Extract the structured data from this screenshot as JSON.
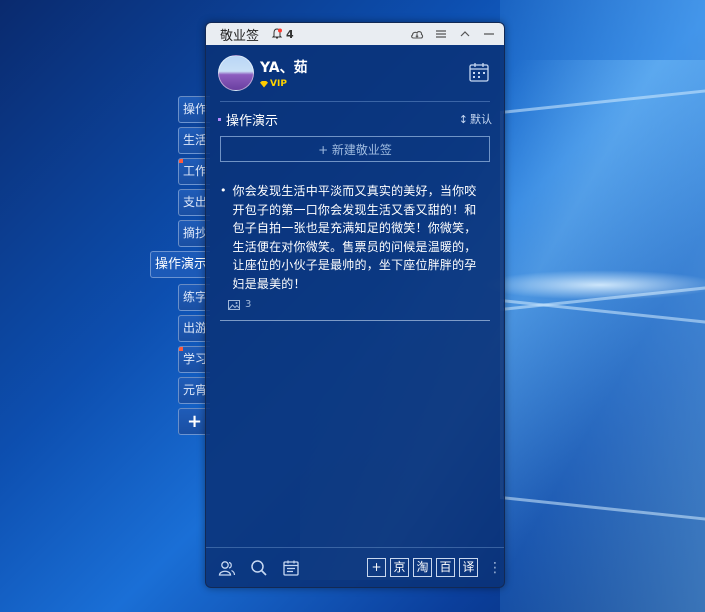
{
  "window": {
    "title": "敬业签",
    "notification_count": "4"
  },
  "profile": {
    "username": "YA、茹",
    "vip_label": "VIP"
  },
  "side_tabs": [
    {
      "label": "操作",
      "active": false
    },
    {
      "label": "生活",
      "active": false
    },
    {
      "label": "工作",
      "active": false
    },
    {
      "label": "支出",
      "active": false
    },
    {
      "label": "摘抄",
      "active": false
    },
    {
      "label": "操作演示",
      "active": true
    },
    {
      "label": "练字",
      "active": false
    },
    {
      "label": "出游",
      "active": false
    },
    {
      "label": "学习",
      "active": false
    },
    {
      "label": "元宵",
      "active": false
    }
  ],
  "side_add_label": "+",
  "section": {
    "title": "操作演示",
    "sort_label": "默认",
    "sort_icon": "↕"
  },
  "new_note_label": "+ 新建敬业签",
  "note": {
    "text": "你会发现生活中平淡而又真实的美好，当你咬开包子的第一口你会发现生活又香又甜的！和包子自拍一张也是充满知足的微笑！你微笑，生活便在对你微笑。售票员的问候是温暖的，让座位的小伙子是最帅的，坐下座位胖胖的孕妇是最美的！",
    "image_count": "3"
  },
  "bottom_tools": [
    "京",
    "淘",
    "百",
    "译"
  ],
  "bottom_add_label": "+",
  "colors": {
    "accent": "#1c5ab8",
    "vip": "#ffd400",
    "panel": "#0a3278"
  }
}
